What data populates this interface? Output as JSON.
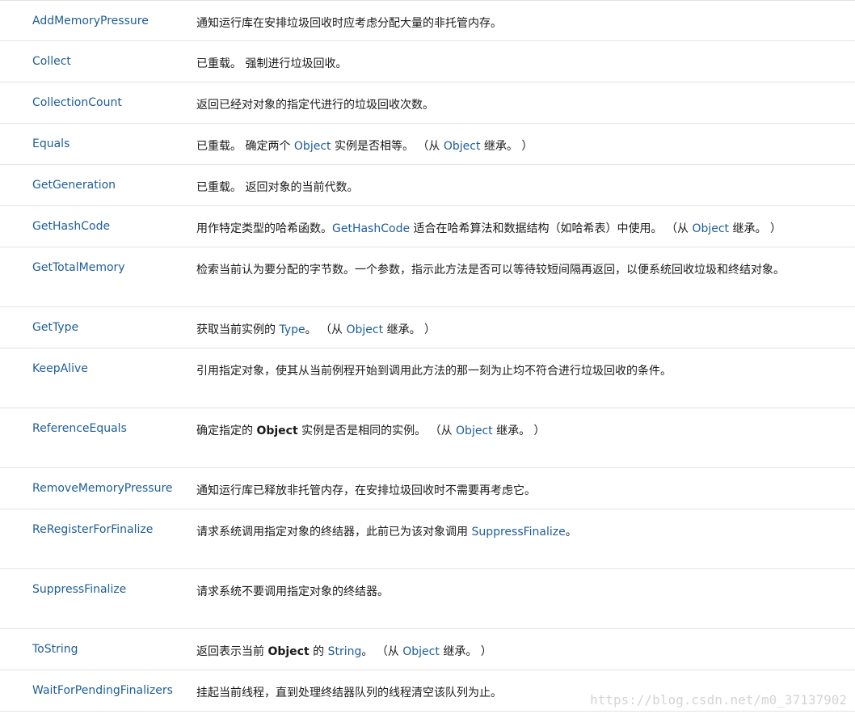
{
  "rows": [
    {
      "name": "AddMemoryPressure",
      "desc": [
        {
          "t": "通知运行库在安排垃圾回收时应考虑分配大量的非托管内存。"
        }
      ]
    },
    {
      "name": "Collect",
      "desc": [
        {
          "t": "已重载。 强制进行垃圾回收。"
        }
      ]
    },
    {
      "name": "CollectionCount",
      "desc": [
        {
          "t": "返回已经对对象的指定代进行的垃圾回收次数。"
        }
      ]
    },
    {
      "name": "Equals",
      "desc": [
        {
          "t": "已重载。 确定两个 "
        },
        {
          "t": "Object",
          "k": "link"
        },
        {
          "t": " 实例是否相等。 （从 "
        },
        {
          "t": "Object",
          "k": "link"
        },
        {
          "t": " 继承。 ）"
        }
      ]
    },
    {
      "name": "GetGeneration",
      "desc": [
        {
          "t": "已重载。 返回对象的当前代数。"
        }
      ]
    },
    {
      "name": "GetHashCode",
      "desc": [
        {
          "t": "用作特定类型的哈希函数。"
        },
        {
          "t": "GetHashCode",
          "k": "link"
        },
        {
          "t": " 适合在哈希算法和数据结构（如哈希表）中使用。 （从 "
        },
        {
          "t": "Object",
          "k": "link"
        },
        {
          "t": " 继承。 ）"
        }
      ]
    },
    {
      "name": "GetTotalMemory",
      "tall": true,
      "desc": [
        {
          "t": "检索当前认为要分配的字节数。一个参数，指示此方法是否可以等待较短间隔再返回，以便系统回收垃圾和终结对象。"
        }
      ]
    },
    {
      "name": "GetType",
      "desc": [
        {
          "t": "获取当前实例的 "
        },
        {
          "t": "Type",
          "k": "link"
        },
        {
          "t": "。 （从 "
        },
        {
          "t": "Object",
          "k": "link"
        },
        {
          "t": " 继承。 ）"
        }
      ]
    },
    {
      "name": "KeepAlive",
      "tall": true,
      "desc": [
        {
          "t": "引用指定对象，使其从当前例程开始到调用此方法的那一刻为止均不符合进行垃圾回收的条件。"
        }
      ]
    },
    {
      "name": "ReferenceEquals",
      "tall": true,
      "desc": [
        {
          "t": "确定指定的 "
        },
        {
          "t": "Object",
          "k": "strong"
        },
        {
          "t": " 实例是否是相同的实例。 （从 "
        },
        {
          "t": "Object",
          "k": "link"
        },
        {
          "t": " 继承。 ）"
        }
      ]
    },
    {
      "name": "RemoveMemoryPressure",
      "desc": [
        {
          "t": "通知运行库已释放非托管内存，在安排垃圾回收时不需要再考虑它。"
        }
      ]
    },
    {
      "name": "ReRegisterForFinalize",
      "tall": true,
      "desc": [
        {
          "t": "请求系统调用指定对象的终结器，此前已为该对象调用 "
        },
        {
          "t": "SuppressFinalize",
          "k": "link"
        },
        {
          "t": "。"
        }
      ]
    },
    {
      "name": "SuppressFinalize",
      "tall": true,
      "desc": [
        {
          "t": "请求系统不要调用指定对象的终结器。"
        }
      ]
    },
    {
      "name": "ToString",
      "desc": [
        {
          "t": "返回表示当前 "
        },
        {
          "t": "Object",
          "k": "strong"
        },
        {
          "t": " 的 "
        },
        {
          "t": "String",
          "k": "link"
        },
        {
          "t": "。 （从 "
        },
        {
          "t": "Object",
          "k": "link"
        },
        {
          "t": " 继承。 ）"
        }
      ]
    },
    {
      "name": "WaitForPendingFinalizers",
      "desc": [
        {
          "t": "挂起当前线程，直到处理终结器队列的线程清空该队列为止。"
        }
      ]
    }
  ],
  "watermark": "https://blog.csdn.net/m0_37137902"
}
